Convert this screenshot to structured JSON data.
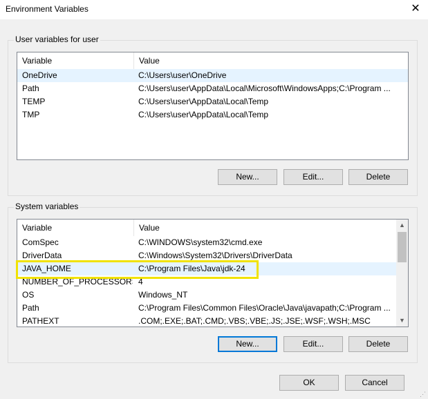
{
  "window": {
    "title": "Environment Variables",
    "close_glyph": "✕"
  },
  "user_group": {
    "label": "User variables for user",
    "columns": [
      "Variable",
      "Value"
    ],
    "rows": [
      {
        "variable": "OneDrive",
        "value": "C:\\Users\\user\\OneDrive",
        "selected": true
      },
      {
        "variable": "Path",
        "value": "C:\\Users\\user\\AppData\\Local\\Microsoft\\WindowsApps;C:\\Program ..."
      },
      {
        "variable": "TEMP",
        "value": "C:\\Users\\user\\AppData\\Local\\Temp"
      },
      {
        "variable": "TMP",
        "value": "C:\\Users\\user\\AppData\\Local\\Temp"
      }
    ],
    "buttons": {
      "new": "New...",
      "edit": "Edit...",
      "delete": "Delete"
    }
  },
  "system_group": {
    "label": "System variables",
    "columns": [
      "Variable",
      "Value"
    ],
    "rows": [
      {
        "variable": "ComSpec",
        "value": "C:\\WINDOWS\\system32\\cmd.exe"
      },
      {
        "variable": "DriverData",
        "value": "C:\\Windows\\System32\\Drivers\\DriverData"
      },
      {
        "variable": "JAVA_HOME",
        "value": "C:\\Program Files\\Java\\jdk-24",
        "selected": true
      },
      {
        "variable": "NUMBER_OF_PROCESSORS",
        "value": "4"
      },
      {
        "variable": "OS",
        "value": "Windows_NT"
      },
      {
        "variable": "Path",
        "value": "C:\\Program Files\\Common Files\\Oracle\\Java\\javapath;C:\\Program ..."
      },
      {
        "variable": "PATHEXT",
        "value": ".COM;.EXE;.BAT;.CMD;.VBS;.VBE;.JS;.JSE;.WSF;.WSH;.MSC"
      }
    ],
    "buttons": {
      "new": "New...",
      "edit": "Edit...",
      "delete": "Delete"
    },
    "scroll": {
      "up_glyph": "▲",
      "down_glyph": "▼"
    }
  },
  "dialog_buttons": {
    "ok": "OK",
    "cancel": "Cancel"
  },
  "colors": {
    "highlight": "#f1e200",
    "selection": "#e5f3ff",
    "default_button_border": "#0078d7"
  }
}
